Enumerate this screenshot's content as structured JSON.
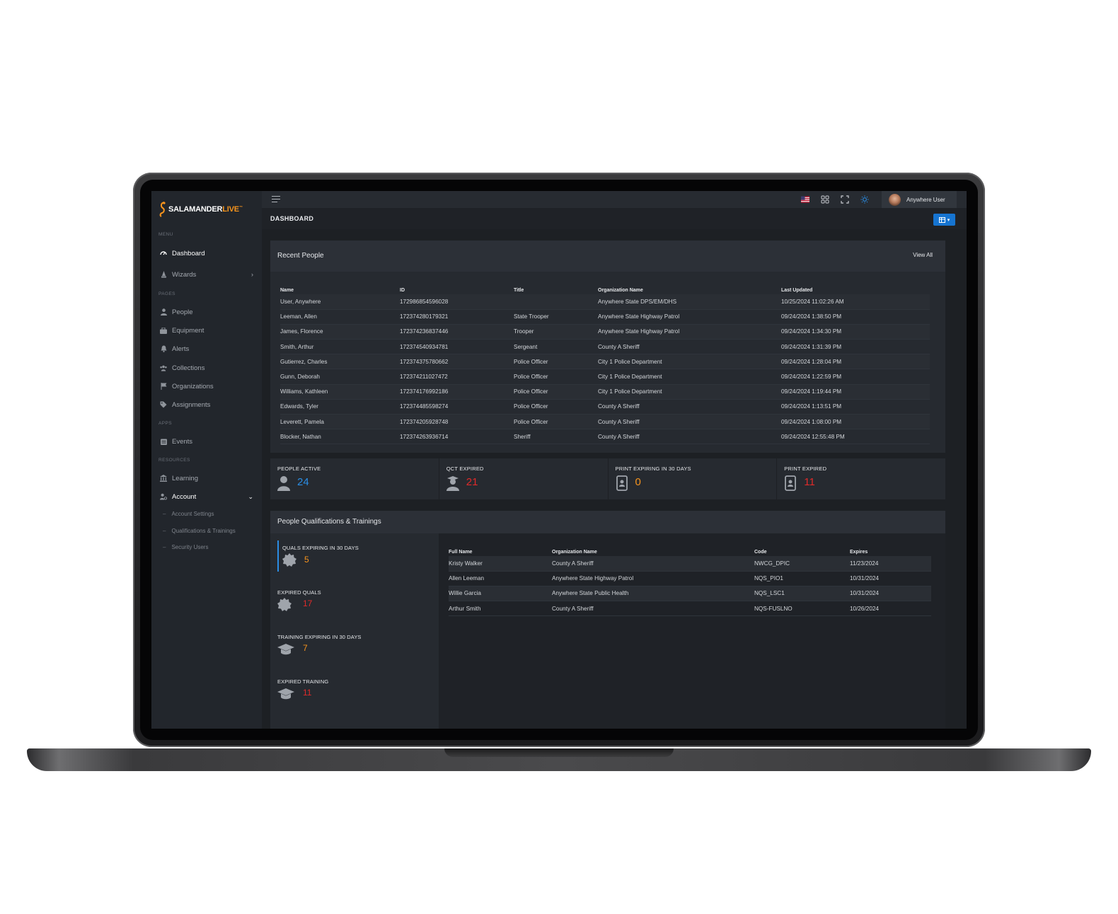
{
  "app": {
    "logo_main": "SALAMANDER",
    "logo_accent": "LIVE",
    "logo_tm": "™"
  },
  "colors": {
    "accent_blue": "#2a8de4",
    "warning_orange": "#f7941d",
    "danger_red": "#e02a2a",
    "bg": "#1d2024",
    "panel": "#262a30"
  },
  "sidebar": {
    "sections": {
      "menu": "MENU",
      "pages": "PAGES",
      "apps": "APPS",
      "resources": "RESOURCES"
    },
    "items": [
      {
        "label": "Dashboard",
        "icon": "gauge-icon"
      },
      {
        "label": "Wizards",
        "icon": "wizard-icon"
      },
      {
        "label": "People",
        "icon": "person-icon"
      },
      {
        "label": "Equipment",
        "icon": "toolbox-icon"
      },
      {
        "label": "Alerts",
        "icon": "bell-icon"
      },
      {
        "label": "Collections",
        "icon": "users-icon"
      },
      {
        "label": "Organizations",
        "icon": "flag-icon"
      },
      {
        "label": "Assignments",
        "icon": "tag-icon"
      },
      {
        "label": "Events",
        "icon": "calendar-icon"
      },
      {
        "label": "Learning",
        "icon": "institution-icon"
      },
      {
        "label": "Account",
        "icon": "user-gear-icon"
      }
    ],
    "account_sub": [
      "Account Settings",
      "Qualifications & Trainings",
      "Security Users"
    ]
  },
  "topbar": {
    "user_name": "Anywhere User",
    "icons": [
      "us-flag-icon",
      "apps-grid-icon",
      "fullscreen-icon",
      "theme-sun-icon"
    ]
  },
  "page": {
    "title": "DASHBOARD"
  },
  "recent_people": {
    "title": "Recent People",
    "view_all": "View All",
    "columns": [
      "Name",
      "ID",
      "Title",
      "Organization Name",
      "Last Updated"
    ],
    "rows": [
      [
        "User, Anywhere",
        "172986854596028",
        "",
        "Anywhere State DPS/EM/DHS",
        "10/25/2024 11:02:26 AM"
      ],
      [
        "Leeman, Allen",
        "172374280179321",
        "State Trooper",
        "Anywhere State Highway Patrol",
        "09/24/2024 1:38:50 PM"
      ],
      [
        "James, Florence",
        "172374236837446",
        "Trooper",
        "Anywhere State Highway Patrol",
        "09/24/2024 1:34:30 PM"
      ],
      [
        "Smith, Arthur",
        "172374540934781",
        "Sergeant",
        "County A Sheriff",
        "09/24/2024 1:31:39 PM"
      ],
      [
        "Gutierrez, Charles",
        "172374375780662",
        "Police Officer",
        "City 1 Police Department",
        "09/24/2024 1:28:04 PM"
      ],
      [
        "Gunn, Deborah",
        "172374211027472",
        "Police Officer",
        "City 1 Police Department",
        "09/24/2024 1:22:59 PM"
      ],
      [
        "Williams, Kathleen",
        "172374176992186",
        "Police Officer",
        "City 1 Police Department",
        "09/24/2024 1:19:44 PM"
      ],
      [
        "Edwards, Tyler",
        "172374485598274",
        "Police Officer",
        "County A Sheriff",
        "09/24/2024 1:13:51 PM"
      ],
      [
        "Leverett, Pamela",
        "172374205928748",
        "Police Officer",
        "County A Sheriff",
        "09/24/2024 1:08:00 PM"
      ],
      [
        "Blocker, Nathan",
        "172374263936714",
        "Sheriff",
        "County A Sheriff",
        "09/24/2024 12:55:48 PM"
      ]
    ]
  },
  "stats": [
    {
      "label": "PEOPLE ACTIVE",
      "value": "24",
      "icon": "person-icon"
    },
    {
      "label": "QCT EXPIRED",
      "value": "21",
      "icon": "graduate-icon"
    },
    {
      "label": "PRINT EXPIRING IN 30 DAYS",
      "value": "0",
      "icon": "id-badge-icon"
    },
    {
      "label": "PRINT EXPIRED",
      "value": "11",
      "icon": "id-badge-icon"
    }
  ],
  "quals": {
    "title": "People Qualifications & Trainings",
    "summary": [
      {
        "label": "QUALS EXPIRING IN 30 DAYS",
        "value": "5",
        "icon": "certificate-icon"
      },
      {
        "label": "EXPIRED QUALS",
        "value": "17",
        "icon": "certificate-icon"
      },
      {
        "label": "TRAINING EXPIRING IN 30 DAYS",
        "value": "7",
        "icon": "graduation-cap-icon"
      },
      {
        "label": "EXPIRED TRAINING",
        "value": "11",
        "icon": "graduation-cap-icon"
      }
    ],
    "columns": [
      "Full Name",
      "Organization Name",
      "Code",
      "Expires"
    ],
    "rows": [
      [
        "Kristy Walker",
        "County A Sheriff",
        "NWCG_DPIC",
        "11/23/2024"
      ],
      [
        "Allen Leeman",
        "Anywhere State Highway Patrol",
        "NQS_PIO1",
        "10/31/2024"
      ],
      [
        "Willie Garcia",
        "Anywhere State Public Health",
        "NQS_LSC1",
        "10/31/2024"
      ],
      [
        "Arthur Smith",
        "County A Sheriff",
        "NQS-FUSLNO",
        "10/26/2024"
      ]
    ]
  }
}
